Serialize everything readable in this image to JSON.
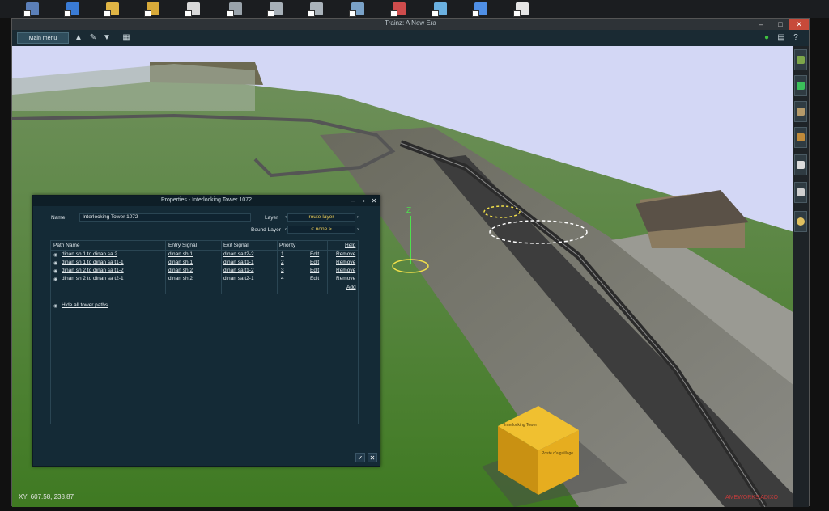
{
  "window": {
    "title": "Trainz: A New Era",
    "minimize": "–",
    "maximize": "□",
    "close": "✕"
  },
  "toolbar": {
    "main_menu": "Main menu"
  },
  "status": {
    "xy": "XY: 607.58, 238.87",
    "watermark": "AMEWORKS ADIXO"
  },
  "dialog": {
    "title": "Properties - Interlocking Tower 1072",
    "name_label": "Name",
    "name_value": "Interlocking Tower 1072",
    "layer_label": "Layer",
    "layer_value": "route-layer",
    "bound_layer_label": "Bound Layer",
    "bound_layer_value": "< none >",
    "columns": {
      "path_name": "Path Name",
      "entry_signal": "Entry Signal",
      "exit_signal": "Exit Signal",
      "priority": "Priority",
      "help": "Help"
    },
    "rows": [
      {
        "name": "dinan sh 1 to dinan sa 2",
        "entry": "dinan sh 1",
        "exit": "dinan sa t2-2",
        "priority": "1",
        "edit": "Edit",
        "remove": "Remove"
      },
      {
        "name": "dinan sh 1 to dinan sa t1-1",
        "entry": "dinan sh 1",
        "exit": "dinan sa t1-1",
        "priority": "2",
        "edit": "Edit",
        "remove": "Remove"
      },
      {
        "name": "dinan sh 2 to dinan sa t1-2",
        "entry": "dinan sh 2",
        "exit": "dinan sa t1-2",
        "priority": "3",
        "edit": "Edit",
        "remove": "Remove"
      },
      {
        "name": "dinan sh 2 to dinan sa t2-1",
        "entry": "dinan sh 2",
        "exit": "dinan sa t2-1",
        "priority": "4",
        "edit": "Edit",
        "remove": "Remove"
      }
    ],
    "add": "Add",
    "hide_all": "Hide all tower paths",
    "ok": "✓",
    "cancel": "✕"
  },
  "scene": {
    "gizmo_label": "Z",
    "box_text_1": "Interlocking Tower",
    "box_text_2": "Poste d'aiguillage"
  },
  "colors": {
    "sky": "#d3d7f5",
    "grass": "#5a8a3a",
    "dialog": "#142a36",
    "accent_yellow": "#f2d25a",
    "box": "#e6ad1f"
  }
}
